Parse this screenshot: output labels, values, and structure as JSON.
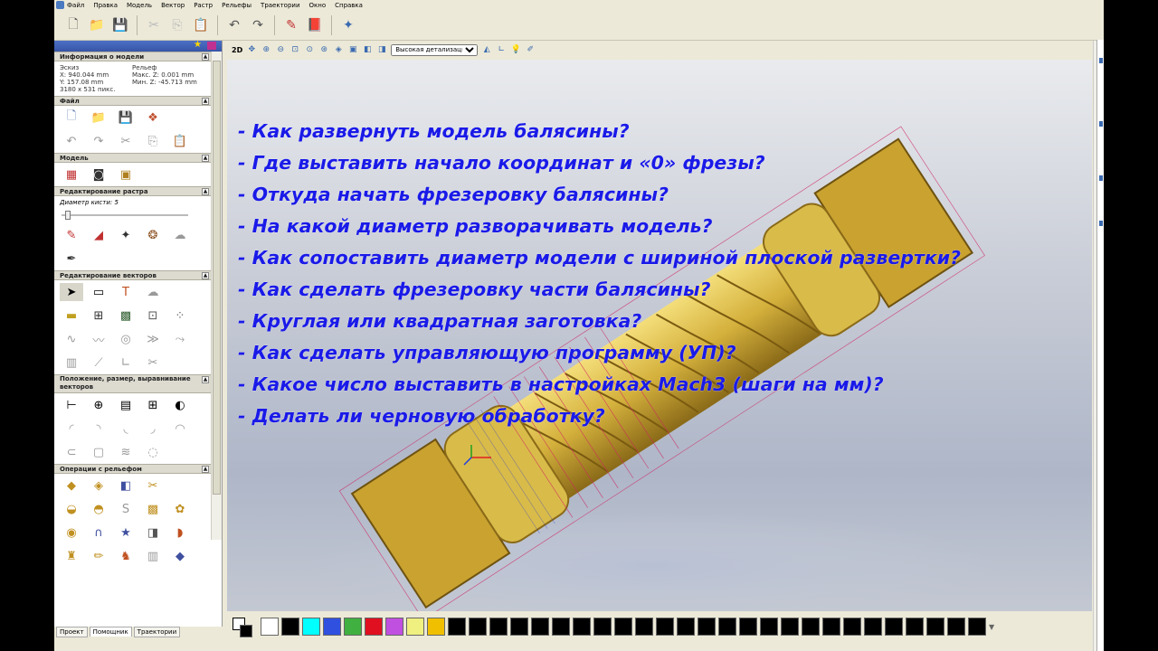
{
  "menu": [
    "Файл",
    "Правка",
    "Модель",
    "Вектор",
    "Растр",
    "Рельефы",
    "Траектории",
    "Окно",
    "Справка"
  ],
  "panel": {
    "model_info": {
      "title": "Информация о модели",
      "sketch_label": "Эскиз",
      "relief_label": "Рельеф",
      "x": "X: 940.044 mm",
      "y": "Y: 157.08 mm",
      "pixels": "3180 x 531 пикс.",
      "max_z": "Макс. Z: 0.001 mm",
      "min_z": "Мин. Z: -45.713 mm"
    },
    "sections": {
      "file": "Файл",
      "model": "Модель",
      "raster": "Редактирование растра",
      "vectors": "Редактирование векторов",
      "position": "Положение, размер, выравнивание векторов",
      "relief_ops": "Операции с рельефом"
    },
    "brush_label": "Диаметр кисти:",
    "brush_value": "5",
    "tabs": [
      "Проект",
      "Помощник",
      "Траектории"
    ]
  },
  "viewbar": {
    "mode": "2D",
    "detail": "Высокая детализация"
  },
  "overlay_lines": [
    "- Как развернуть модель балясины?",
    "- Где выставить начало координат и «0» фрезы?",
    "- Откуда начать фрезеровку балясины?",
    "- На какой диаметр разворачивать модель?",
    "- Как сопоставить диаметр модели с шириной плоской развертки?",
    "- Как сделать фрезеровку части балясины?",
    "- Круглая или квадратная заготовка?",
    "- Как сделать управляющую программу (УП)?",
    "- Какое число выставить в настройках Mach3 (шаги на мм)?",
    "- Делать ли черновую обработку?"
  ],
  "palette_colors": [
    "#ffffff",
    "#000000",
    "#00ffff",
    "#3050e0",
    "#40b040",
    "#e01020",
    "#c050e0",
    "#f0f080",
    "#f0c000",
    "#000000",
    "#000000",
    "#000000",
    "#000000",
    "#000000",
    "#000000",
    "#000000",
    "#000000",
    "#000000",
    "#000000",
    "#000000",
    "#000000",
    "#000000",
    "#000000",
    "#000000",
    "#000000",
    "#000000",
    "#000000",
    "#000000",
    "#000000",
    "#000000",
    "#000000",
    "#000000",
    "#000000",
    "#000000",
    "#000000"
  ],
  "colors": {
    "overlay_text": "#1a1ae8",
    "model_gold": "#d4b03c",
    "panel_header": "#3755a6"
  }
}
